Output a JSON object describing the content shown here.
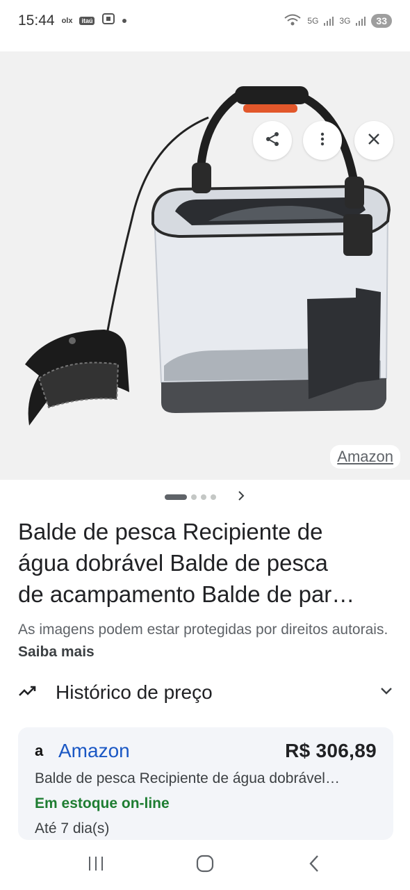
{
  "status": {
    "time": "15:44",
    "app_icons": [
      "olx",
      "itaú"
    ],
    "net_5g": "5G",
    "net_3g": "3G",
    "battery": "33"
  },
  "hero": {
    "source": "Amazon",
    "icons": [
      "share-icon",
      "more-vert-icon",
      "close-icon"
    ]
  },
  "pager": {
    "count": 4,
    "active_index": 0
  },
  "product": {
    "title_lines": [
      "Balde de pesca Recipiente de",
      "água dobrável Balde de pesca",
      "de acampamento Balde de par…"
    ],
    "copyright_text": "As imagens podem estar protegidas por direitos autorais.",
    "learn_more": "Saiba mais"
  },
  "price_history": {
    "label": "Histórico de preço"
  },
  "offer": {
    "logo": "a",
    "merchant": "Amazon",
    "price": "R$ 306,89",
    "description": "Balde de pesca Recipiente de água dobrável…",
    "stock": "Em estoque on-line",
    "delivery": "Até 7 dia(s)"
  },
  "colors": {
    "link": "#1a57c4",
    "in_stock": "#1e7d32",
    "card_bg": "#f3f5f9"
  }
}
